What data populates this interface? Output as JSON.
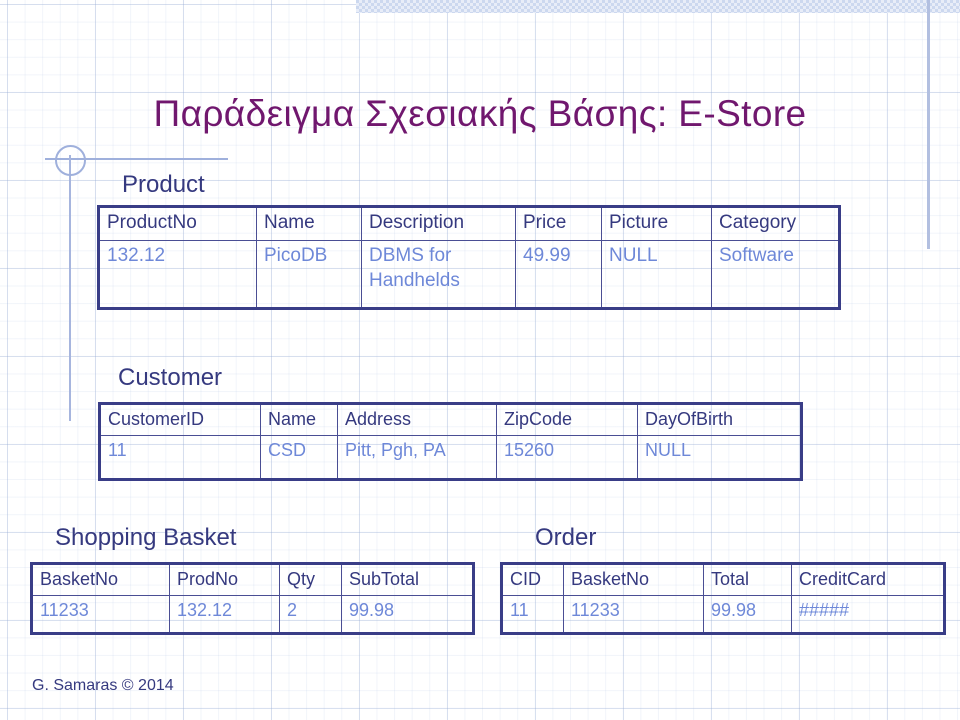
{
  "slide": {
    "title": "Παράδειγμα Σχεσιακής Βάσης: E-Store",
    "footer": "G. Samaras © 2014",
    "colors": {
      "title": "#70176E",
      "table_border": "#393D87",
      "header_text": "#35397F",
      "data_text": "#6E88D8",
      "banner": "#ccd8ef",
      "deco_line": "#9fb0dc",
      "grid": "#96aad2"
    }
  },
  "tables": {
    "product": {
      "caption": "Product",
      "columns": [
        "ProductNo",
        "Name",
        "Description",
        "Price",
        "Picture",
        "Category"
      ],
      "rows": [
        [
          "132.12",
          "PicoDB",
          "DBMS for Handhelds",
          "49.99",
          "NULL",
          "Software"
        ]
      ]
    },
    "customer": {
      "caption": "Customer",
      "columns": [
        "CustomerID",
        "Name",
        "Address",
        "ZipCode",
        "DayOfBirth"
      ],
      "rows": [
        [
          "11",
          "CSD",
          "Pitt, Pgh, PA",
          "15260",
          "NULL"
        ]
      ]
    },
    "basket": {
      "caption": "Shopping Basket",
      "columns": [
        "BasketNo",
        "ProdNo",
        "Qty",
        "SubTotal"
      ],
      "rows": [
        [
          "11233",
          "132.12",
          "2",
          "99.98"
        ]
      ]
    },
    "order": {
      "caption": "Order",
      "columns": [
        "CID",
        "BasketNo",
        "Total",
        "CreditCard"
      ],
      "rows": [
        [
          "11",
          "11233",
          "99.98",
          "#####"
        ]
      ]
    }
  }
}
